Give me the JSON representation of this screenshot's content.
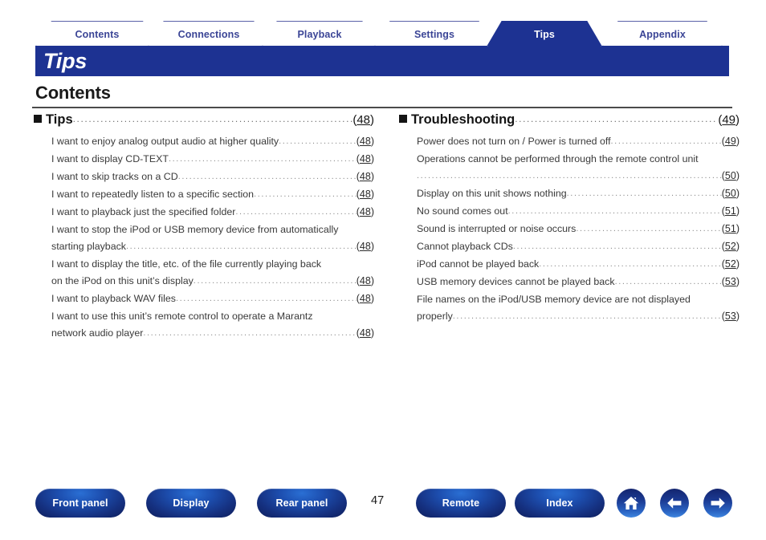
{
  "tabs": [
    {
      "label": "Contents",
      "active": false
    },
    {
      "label": "Connections",
      "active": false
    },
    {
      "label": "Playback",
      "active": false
    },
    {
      "label": "Settings",
      "active": false
    },
    {
      "label": "Tips",
      "active": true
    },
    {
      "label": "Appendix",
      "active": false
    }
  ],
  "banner": {
    "title": "Tips"
  },
  "page_heading": "Contents",
  "columns": {
    "left": {
      "section": {
        "label": "Tips",
        "page": "48"
      },
      "entries": [
        {
          "lines": [
            "I want to enjoy analog output audio at higher quality"
          ],
          "page": "48"
        },
        {
          "lines": [
            "I want to display CD-TEXT"
          ],
          "page": "48"
        },
        {
          "lines": [
            "I want to skip tracks on a CD "
          ],
          "page": "48"
        },
        {
          "lines": [
            "I want to repeatedly listen to a specific section "
          ],
          "page": "48"
        },
        {
          "lines": [
            "I want to playback just the specified folder"
          ],
          "page": "48"
        },
        {
          "lines": [
            "I want to stop the iPod or USB memory device from automatically",
            "starting playback"
          ],
          "page": "48"
        },
        {
          "lines": [
            "I want to display the title, etc. of the file currently playing back",
            "on the iPod on this unit’s display"
          ],
          "page": "48"
        },
        {
          "lines": [
            "I want to playback WAV files"
          ],
          "page": "48"
        },
        {
          "lines": [
            "I want to use this unit’s remote control to operate a Marantz",
            "network audio player "
          ],
          "page": "48"
        }
      ]
    },
    "right": {
      "section": {
        "label": "Troubleshooting ",
        "page": "49"
      },
      "entries": [
        {
          "lines": [
            "Power does not turn on / Power is turned off "
          ],
          "page": "49"
        },
        {
          "lines": [
            "Operations cannot be performed through the remote control unit",
            " "
          ],
          "page": "50"
        },
        {
          "lines": [
            "Display on this unit shows nothing "
          ],
          "page": "50"
        },
        {
          "lines": [
            "No sound comes out"
          ],
          "page": "51"
        },
        {
          "lines": [
            "Sound is interrupted or noise occurs"
          ],
          "page": "51"
        },
        {
          "lines": [
            "Cannot playback CDs "
          ],
          "page": "52"
        },
        {
          "lines": [
            "iPod cannot be played back"
          ],
          "page": "52"
        },
        {
          "lines": [
            "USB memory devices cannot be played back "
          ],
          "page": "53"
        },
        {
          "lines": [
            "File names on the iPod/USB memory device are not displayed",
            "properly "
          ],
          "page": "53"
        }
      ]
    }
  },
  "footer": {
    "buttons": [
      {
        "id": "front",
        "label": "Front panel"
      },
      {
        "id": "display",
        "label": "Display"
      },
      {
        "id": "rear",
        "label": "Rear panel"
      },
      {
        "id": "remote",
        "label": "Remote"
      },
      {
        "id": "index",
        "label": "Index"
      }
    ],
    "page_number": "47",
    "icons": [
      {
        "id": "home",
        "name": "home-icon"
      },
      {
        "id": "back",
        "name": "arrow-left-icon"
      },
      {
        "id": "forward",
        "name": "arrow-right-icon"
      }
    ]
  },
  "colors": {
    "brand_blue": "#1d3292",
    "tab_text": "#3b4596",
    "tab_border": "#5a62a8",
    "body_text": "#3a3a3a",
    "leader": "#8d8d8d"
  }
}
